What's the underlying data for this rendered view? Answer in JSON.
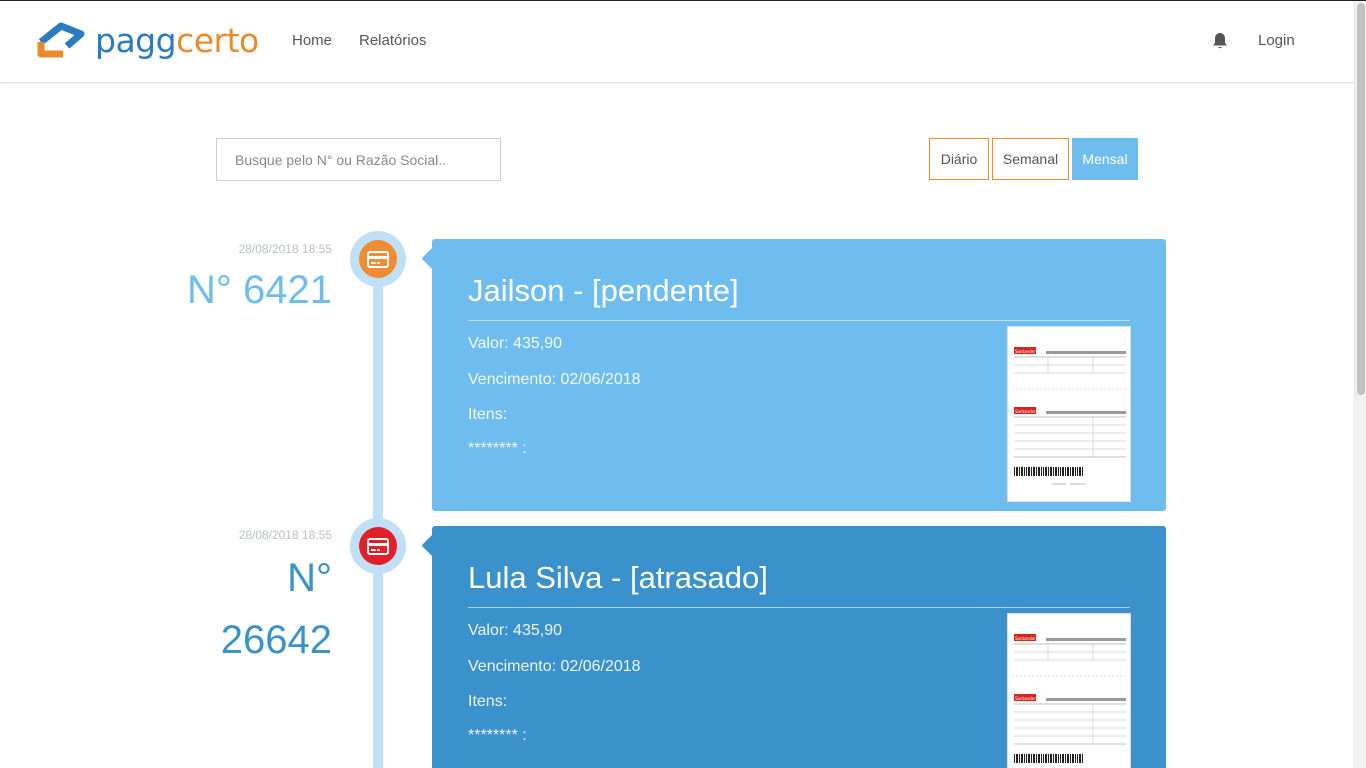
{
  "navbar": {
    "logo": {
      "part1": "pagg",
      "part2": "certo"
    },
    "links": {
      "home": "Home",
      "relatorios": "Relatórios",
      "login": "Login"
    },
    "bell_icon": "bell-icon"
  },
  "search": {
    "placeholder": "Busque pelo N° ou Razão Social.."
  },
  "filters": {
    "diario": "Diário",
    "semanal": "Semanal",
    "mensal": "Mensal",
    "active": "Mensal"
  },
  "colors": {
    "accent_orange": "#e98a2f",
    "light_blue": "#6ebdee",
    "dark_blue": "#3a91cc",
    "red": "#e01f26"
  },
  "timeline": [
    {
      "date": "28/08/2018 18:55",
      "number": "N° 6421",
      "icon": "credit-card-icon",
      "title": "Jailson - [pendente]",
      "valor": "Valor: 435,90",
      "vencimento": "Vencimento: 02/06/2018",
      "itens": "Itens:",
      "item_line": "******** :",
      "thumbnail_bank": "Santander"
    },
    {
      "date": "28/08/2018 18:55",
      "number_line1": "N°",
      "number_line2": "26642",
      "icon": "credit-card-icon",
      "title": "Lula Silva - [atrasado]",
      "valor": "Valor: 435,90",
      "vencimento": "Vencimento: 02/06/2018",
      "itens": "Itens:",
      "item_line": "******** :",
      "thumbnail_bank": "Santander"
    }
  ]
}
